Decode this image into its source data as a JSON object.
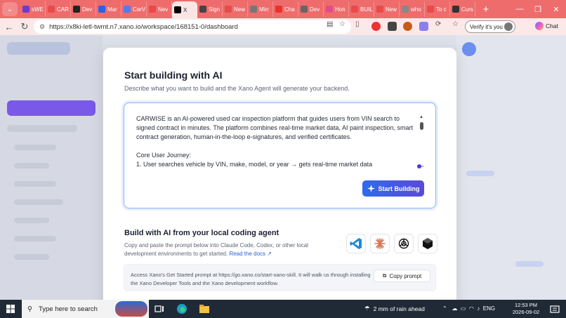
{
  "browser": {
    "tabs": [
      {
        "label": "sWE",
        "color": "#6a3cc9"
      },
      {
        "label": "CAR",
        "color": "#e84a4a"
      },
      {
        "label": "Dev",
        "color": "#222222"
      },
      {
        "label": "Mar",
        "color": "#2563eb"
      },
      {
        "label": "CarV",
        "color": "#4e7df0"
      },
      {
        "label": "Nev",
        "color": "#e84a4a"
      },
      {
        "label": "X",
        "color": "#000000",
        "active": true
      },
      {
        "label": "Sign",
        "color": "#444444"
      },
      {
        "label": "New",
        "color": "#e84a4a"
      },
      {
        "label": "Mirr",
        "color": "#777777"
      },
      {
        "label": "Cha",
        "color": "#e8332b"
      },
      {
        "label": "Dev",
        "color": "#666666"
      },
      {
        "label": "Hon",
        "color": "#e04c8a"
      },
      {
        "label": "BUIL",
        "color": "#e84a4a"
      },
      {
        "label": "New",
        "color": "#e84a4a"
      },
      {
        "label": "who",
        "color": "#888888"
      },
      {
        "label": "To c",
        "color": "#e84a4a"
      },
      {
        "label": "Curs",
        "color": "#333333"
      }
    ],
    "new_tab": "+",
    "url": "https://x8ki-letl-twmt.n7.xano.io/workspace/168151-0/dashboard",
    "verify_label": "Verify it's you",
    "chat_label": "Chat"
  },
  "modal": {
    "title": "Start building with AI",
    "subtitle": "Describe what you want to build and the Xano Agent will generate your backend.",
    "prompt_value": "CARWISE is an AI-powered used car inspection platform that guides users from VIN search to signed contract in minutes. The platform combines real-time market data, AI paint inspection, smart contract generation, human-in-the-loop e-signatures, and verified certificates.\n\nCore User Journey:\n1. User searches vehicle by VIN, make, model, or year → gets real-time market data",
    "start_button": "Start Building",
    "local_title": "Build with AI from your local coding agent",
    "local_text": "Copy and paste the prompt below into Claude Code, Codex, or other local development environments to get started.",
    "read_docs": "Read the docs",
    "copy_text": "Access Xano's Get Started prompt at https://go.xano.co/start-xano-skill. It will walk us through installing the Xano Developer Tools and the Xano development workflow.",
    "copy_button": "Copy prompt",
    "agents": [
      "vscode-icon",
      "claude-icon",
      "openai-icon",
      "cursor-icon"
    ]
  },
  "taskbar": {
    "search_placeholder": "Type here to search",
    "weather": "2 mm of rain ahead",
    "lang": "ENG",
    "time": "12:53 PM",
    "date": "2026-09-02"
  }
}
